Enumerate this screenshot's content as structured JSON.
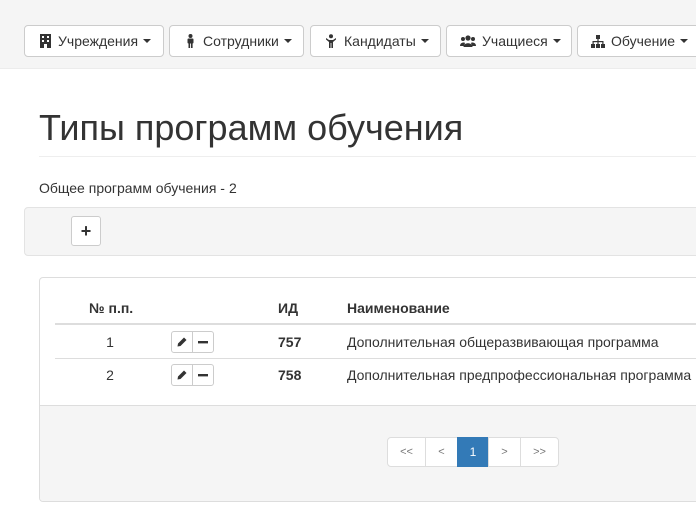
{
  "nav": {
    "items": [
      {
        "label": "Учреждения",
        "icon": "building-icon"
      },
      {
        "label": "Сотрудники",
        "icon": "person-icon"
      },
      {
        "label": "Кандидаты",
        "icon": "child-icon"
      },
      {
        "label": "Учащиеся",
        "icon": "users-icon"
      },
      {
        "label": "Обучение",
        "icon": "sitemap-icon"
      }
    ]
  },
  "page": {
    "title": "Типы программ обучения",
    "summary_label": "Общее программ обучения -",
    "summary_value": "2"
  },
  "toolbar": {
    "add_label": "+"
  },
  "table": {
    "headers": {
      "num": "№ п.п.",
      "id": "ИД",
      "name": "Наименование"
    },
    "rows": [
      {
        "num": "1",
        "id": "757",
        "name": "Дополнительная общеразвивающая программа"
      },
      {
        "num": "2",
        "id": "758",
        "name": "Дополнительная предпрофессиональная программа"
      }
    ]
  },
  "pagination": {
    "first": "<<",
    "prev": "<",
    "current": "1",
    "next": ">",
    "last": ">>"
  },
  "colors": {
    "accent": "#337ab7",
    "navbar_bg": "#f5f5f5",
    "border": "#dddddd"
  }
}
